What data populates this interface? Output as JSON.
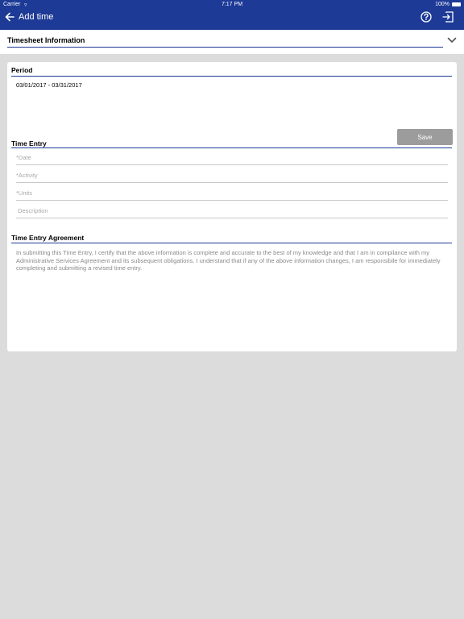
{
  "status_bar": {
    "carrier": "Carrier",
    "wifi_glyph": "▿",
    "time": "7:17 PM",
    "battery": "100%"
  },
  "nav": {
    "title": "Add time",
    "back_icon": "back-arrow-icon",
    "help_icon": "help-circle-icon",
    "logout_icon": "logout-icon"
  },
  "timesheet_info": {
    "title": "Timesheet Information",
    "chevron_icon": "chevron-down-icon"
  },
  "period": {
    "title": "Period",
    "value": "03/01/2017 - 03/31/2017"
  },
  "save_label": "Save",
  "time_entry": {
    "title": "Time Entry",
    "fields": {
      "date": {
        "placeholder": "*Date",
        "value": ""
      },
      "activity": {
        "placeholder": "*Activity",
        "value": ""
      },
      "units": {
        "placeholder": "*Units",
        "value": ""
      },
      "description": {
        "placeholder": " Description",
        "value": ""
      }
    }
  },
  "agreement": {
    "title": "Time Entry Agreement",
    "text": "In submitting this Time Entry, I certify that the above information is complete and accurate to the best of my knowledge and that I am in compilance with my Administrative Services Agreement and its subsequent obligations. I understand that if any of the above information changes, I am responsibile for immediately completing and submitting a revised time entry."
  },
  "colors": {
    "primary": "#1d3a96",
    "background": "#dcdcdc",
    "save_button": "#9c9c9c"
  }
}
